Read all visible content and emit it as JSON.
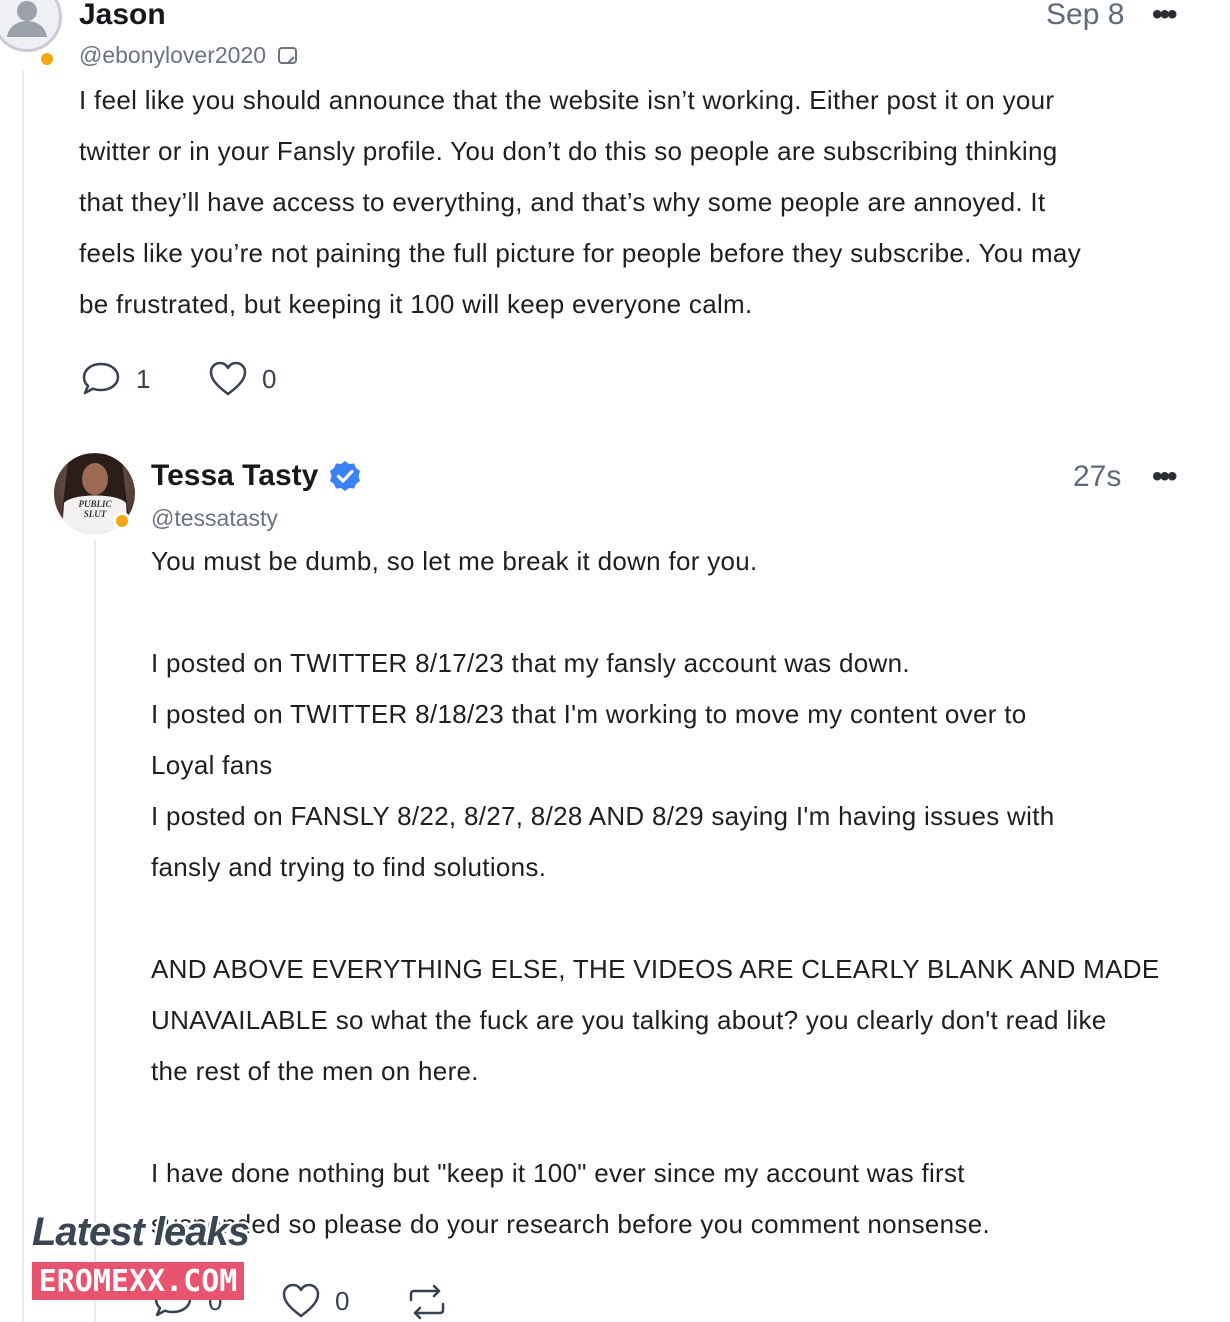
{
  "post1": {
    "name": "Jason",
    "handle": "@ebonylover2020",
    "time": "Sep 8",
    "more_label": "•••",
    "lines": [
      "I feel like you should announce that the website isn’t working. Either post it on your",
      "twitter or in your Fansly profile. You don’t do this so people are subscribing thinking",
      "that they’ll have access to everything, and that’s why some people are annoyed. It",
      "feels like you’re not paining the full picture for people before they subscribe. You may",
      "be frustrated, but keeping it 100 will keep everyone calm."
    ],
    "reply_count": "1",
    "like_count": "0"
  },
  "post2": {
    "name": "Tessa Tasty",
    "handle": "@tessatasty",
    "time": "27s",
    "more_label": "•••",
    "avatar_shirt_text": "PUBLIC SLUT",
    "lines": [
      "You must be dumb, so let me break it down for you.",
      "",
      "I posted on TWITTER 8/17/23 that my fansly account was down.",
      "I posted on TWITTER 8/18/23 that I'm working to move my content over to",
      "Loyal fans",
      "I posted on FANSLY 8/22, 8/27, 8/28 AND 8/29 saying I'm having issues with",
      "fansly and trying to find solutions.",
      "",
      "AND ABOVE EVERYTHING ELSE, THE VIDEOS ARE CLEARLY BLANK AND MADE",
      "UNAVAILABLE so what the fuck are you talking about? you clearly don't read like",
      "the rest of the men on here.",
      "",
      "I have done nothing but \"keep it 100\" ever since my account was first",
      "suspended so please do your research before you comment nonsense."
    ],
    "reply_count": "0",
    "like_count": "0"
  },
  "watermark": {
    "title": "Latest leaks",
    "badge": "EROMEXX.COM"
  },
  "colors": {
    "verified": "#3b82f6",
    "status_dot": "#f3a712",
    "watermark_badge": "#e8546f"
  }
}
